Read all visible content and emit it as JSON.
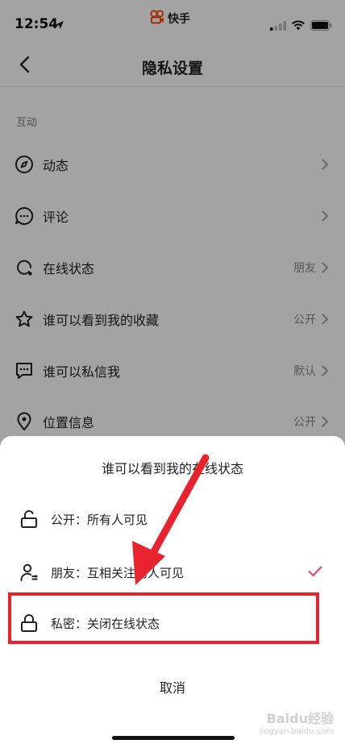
{
  "status_bar": {
    "time": "12:54",
    "app_name": "快手"
  },
  "nav": {
    "title": "隐私设置"
  },
  "section": {
    "header": "互动"
  },
  "settings": [
    {
      "icon": "compass-icon",
      "label": "动态",
      "value": ""
    },
    {
      "icon": "comment-icon",
      "label": "评论",
      "value": ""
    },
    {
      "icon": "online-status-icon",
      "label": "在线状态",
      "value": "朋友"
    },
    {
      "icon": "star-icon",
      "label": "谁可以看到我的收藏",
      "value": "公开"
    },
    {
      "icon": "message-icon",
      "label": "谁可以私信我",
      "value": "默认"
    },
    {
      "icon": "location-icon",
      "label": "位置信息",
      "value": "公开"
    }
  ],
  "sheet": {
    "title": "谁可以看到我的在线状态",
    "options": [
      {
        "icon": "unlock-icon",
        "label": "公开：所有人可见",
        "selected": false
      },
      {
        "icon": "friends-icon",
        "label": "朋友：互相关注的人可见",
        "selected": true
      },
      {
        "icon": "lock-icon",
        "label": "私密：关闭在线状态",
        "selected": false
      }
    ],
    "cancel": "取消"
  },
  "colors": {
    "check": "#e0457b",
    "annotation": "#e8232e"
  },
  "watermark": {
    "main": "Baidu经验",
    "sub": "jingyan.baidu.com"
  }
}
